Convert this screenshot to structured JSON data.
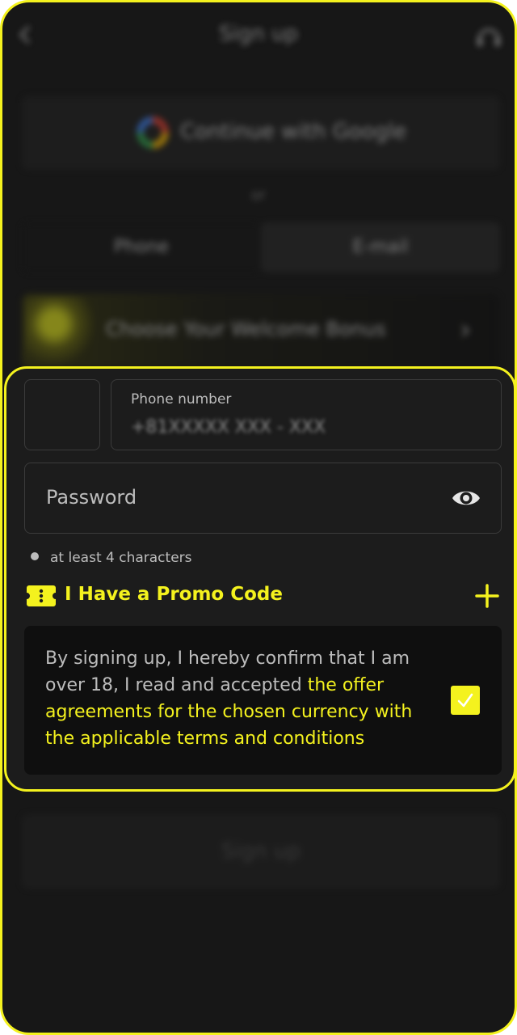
{
  "header": {
    "title": "Sign up"
  },
  "google": {
    "label": "Continue with Google"
  },
  "divider": {
    "or": "or"
  },
  "tabs": [
    {
      "label": "Phone"
    },
    {
      "label": "E-mail"
    }
  ],
  "bonus": {
    "label": "Choose Your Welcome Bonus"
  },
  "phone_field": {
    "label": "Phone number",
    "value": "+81XXXXX XXX - XXX"
  },
  "password_field": {
    "placeholder": "Password"
  },
  "password_hint": {
    "text": "at least 4 characters"
  },
  "promo": {
    "label": "I Have a Promo Code"
  },
  "agreement": {
    "text_plain": "By signing up, I hereby confirm that I am over 18, I read and accepted ",
    "text_link": "the offer agreements for the chosen currency with the applicable terms and conditions",
    "checked": true
  },
  "signup_button": {
    "label": "Sign up"
  },
  "colors": {
    "accent": "#f4f21e",
    "background": "#171717",
    "card": "#1c1c1c"
  }
}
